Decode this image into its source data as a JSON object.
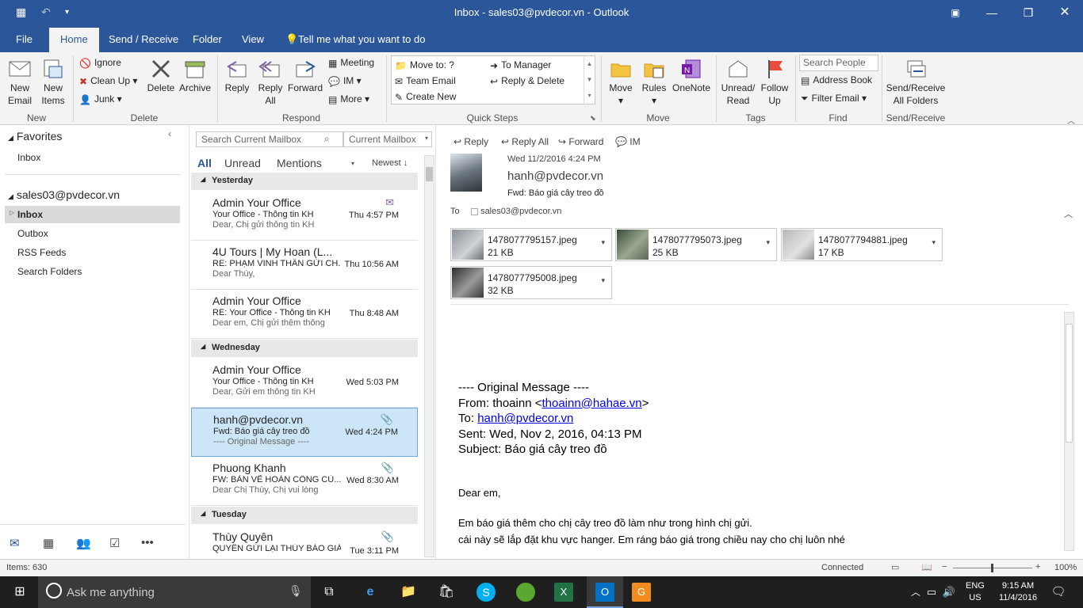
{
  "window": {
    "title": "Inbox - sales03@pvdecor.vn  -  Outlook"
  },
  "tabs": [
    {
      "label": "File"
    },
    {
      "label": "Home"
    },
    {
      "label": "Send / Receive"
    },
    {
      "label": "Folder"
    },
    {
      "label": "View"
    },
    {
      "label": "Tell me what you want to do"
    }
  ],
  "ribbon": {
    "new": {
      "new_email": "New\nEmail",
      "new_items": "New\nItems",
      "group": "New"
    },
    "delete": {
      "ignore": "Ignore",
      "cleanup": "Clean Up",
      "junk": "Junk",
      "delete": "Delete",
      "archive": "Archive",
      "group": "Delete"
    },
    "respond": {
      "reply": "Reply",
      "reply_all": "Reply\nAll",
      "forward": "Forward",
      "meeting": "Meeting",
      "im": "IM",
      "more": "More",
      "group": "Respond"
    },
    "quicksteps": {
      "move_to": "Move to: ?",
      "team_email": "Team Email",
      "create_new": "Create New",
      "to_manager": "To Manager",
      "reply_delete": "Reply & Delete",
      "group": "Quick Steps"
    },
    "move": {
      "move": "Move",
      "rules": "Rules",
      "onenote": "OneNote",
      "group": "Move"
    },
    "tags": {
      "unread_read": "Unread/\nRead",
      "follow_up": "Follow\nUp",
      "group": "Tags"
    },
    "find": {
      "search_people": "Search People",
      "address_book": "Address Book",
      "filter_email": "Filter Email",
      "group": "Find"
    },
    "sendreceive": {
      "all_folders": "Send/Receive\nAll Folders",
      "group": "Send/Receive"
    }
  },
  "nav": {
    "favorites": "Favorites",
    "fav_inbox": "Inbox",
    "account": "sales03@pvdecor.vn",
    "folders": [
      "Inbox",
      "Outbox",
      "RSS Feeds",
      "Search Folders"
    ]
  },
  "list": {
    "search_placeholder": "Search Current Mailbox",
    "scope": "Current Mailbox",
    "filters": {
      "all": "All",
      "unread": "Unread",
      "mentions": "Mentions",
      "sort": "Newest"
    },
    "groups": [
      "Yesterday",
      "Wednesday",
      "Tuesday"
    ],
    "messages": [
      {
        "from": "Admin Your Office",
        "subject": "Your Office - Thông tin KH",
        "preview": "Dear,  Chị gửi thông tin KH",
        "time": "Thu 4:57 PM"
      },
      {
        "from": "4U Tours | My Hoan (L...",
        "subject": "RE: PHẠM VINH THÂN GỬI CH...",
        "preview": "Dear Thúy,",
        "time": "Thu 10:56 AM"
      },
      {
        "from": "Admin Your Office",
        "subject": "RE: Your Office - Thông tin KH",
        "preview": "Dear em,  Chị gửi thêm thông",
        "time": "Thu 8:48 AM"
      },
      {
        "from": "Admin Your Office",
        "subject": "Your Office - Thông tin KH",
        "preview": "Dear,  Gửi em thông tin KH",
        "time": "Wed 5:03 PM"
      },
      {
        "from": "hanh@pvdecor.vn",
        "subject": "Fwd: Báo giá cây treo đồ",
        "preview": "---- Original Message ----",
        "time": "Wed 4:24 PM"
      },
      {
        "from": "Phuong Khanh",
        "subject": "FW: BẢN VẼ HOÀN CÔNG CỦ...",
        "preview": "Dear Chị Thùy,  Chị vui lòng",
        "time": "Wed 8:30 AM"
      },
      {
        "from": "Thùy Quyên",
        "subject": "QUYÊN GỬI LẠI THÚY BÁO GIÁ...",
        "preview": "",
        "time": "Tue 3:11 PM"
      }
    ]
  },
  "reading": {
    "actions": {
      "reply": "Reply",
      "reply_all": "Reply All",
      "forward": "Forward",
      "im": "IM"
    },
    "date": "Wed 11/2/2016 4:24 PM",
    "sender": "hanh@pvdecor.vn",
    "subject": "Fwd: Báo giá cây treo đồ",
    "to_label": "To",
    "to_value": "sales03@pvdecor.vn",
    "attachments": [
      {
        "name": "1478077795157.jpeg",
        "size": "21 KB"
      },
      {
        "name": "1478077795073.jpeg",
        "size": "25 KB"
      },
      {
        "name": "1478077794881.jpeg",
        "size": "17 KB"
      },
      {
        "name": "1478077795008.jpeg",
        "size": "32 KB"
      }
    ],
    "body": {
      "orig": "---- Original Message ----",
      "from_label": "From: thoainn <",
      "from_link": "thoainn@hahae.vn",
      "from_end": ">",
      "to_label": "To: ",
      "to_link": "hanh@pvdecor.vn",
      "sent": "Sent: Wed, Nov 2, 2016, 04:13 PM",
      "subject": "Subject: Báo giá cây treo đồ",
      "greeting": "Dear em,",
      "line1": "Em báo giá thêm cho chị cây treo đồ làm như trong hình chị gửi.",
      "line2": "cái này sẽ lắp đặt khu vực hanger. Em ráng báo giá trong chiều nay cho chị luôn nhé"
    }
  },
  "status": {
    "items": "Items: 630",
    "connected": "Connected",
    "zoom": "100%"
  },
  "taskbar": {
    "search": "Ask me anything",
    "lang1": "ENG",
    "lang2": "US",
    "time": "9:15 AM",
    "date": "11/4/2016"
  },
  "colors": {
    "brand": "#2b579a",
    "selected": "#cde6f7",
    "link": "#0000ee"
  }
}
